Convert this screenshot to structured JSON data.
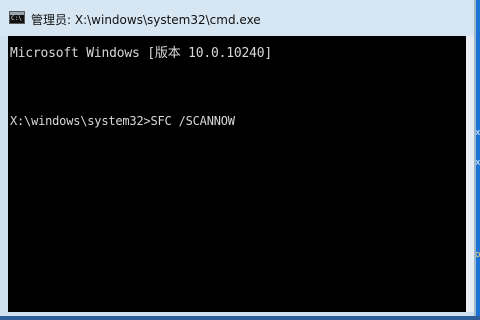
{
  "window": {
    "title": "管理员: X:\\windows\\system32\\cmd.exe",
    "icon": "cmd-icon",
    "icon_text": "C:\\"
  },
  "console": {
    "lines": [
      "Microsoft Windows [版本 10.0.10240]",
      "X:\\windows\\system32>SFC /SCANNOW"
    ]
  },
  "desktop": {
    "fragments": [
      "x",
      "x",
      "o"
    ]
  },
  "colors": {
    "console_bg": "#000000",
    "console_text": "#d8d8d8",
    "titlebar_bg": "#d6e6f2",
    "desktop_bg": "#1c73d6"
  }
}
